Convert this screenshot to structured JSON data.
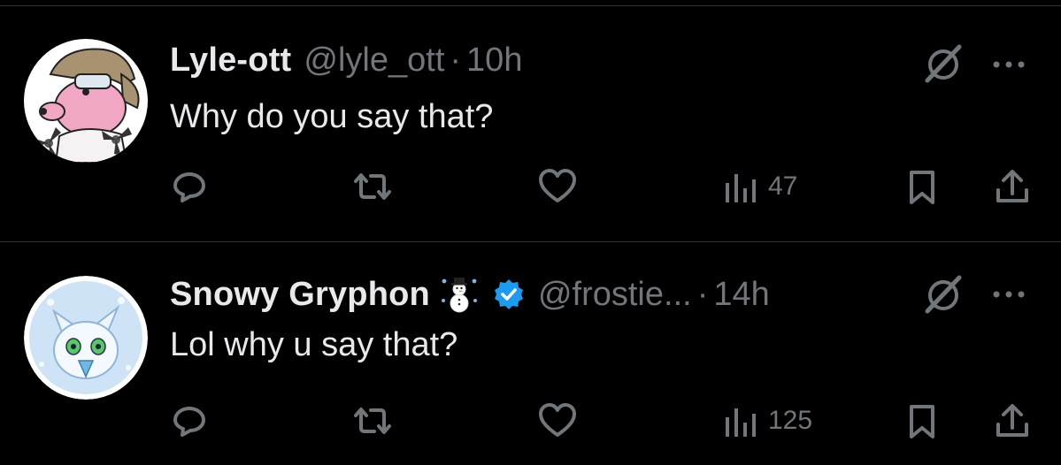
{
  "colors": {
    "background": "#000000",
    "primary_text": "#e7e9ea",
    "secondary_text": "#71767b",
    "divider": "#2f3336",
    "verified_blue": "#1d9bf0"
  },
  "tweets": [
    {
      "display_name": "Lyle-ott",
      "handle": "@lyle_ott",
      "separator": "·",
      "time": "10h",
      "text": "Why do you say that?",
      "views": "47",
      "verified": false,
      "name_emoji": ""
    },
    {
      "display_name": "Snowy Gryphon",
      "handle": "@frostie...",
      "separator": "·",
      "time": "14h",
      "text": "Lol why u say that?",
      "views": "125",
      "verified": true,
      "name_emoji": "snowman-emoji"
    }
  ],
  "icons": {
    "reply": "reply-icon",
    "retweet": "retweet-icon",
    "like": "heart-icon",
    "views": "views-icon",
    "bookmark": "bookmark-icon",
    "share": "share-icon",
    "grok": "grok-icon",
    "more": "more-icon",
    "verified": "verified-badge-icon"
  }
}
